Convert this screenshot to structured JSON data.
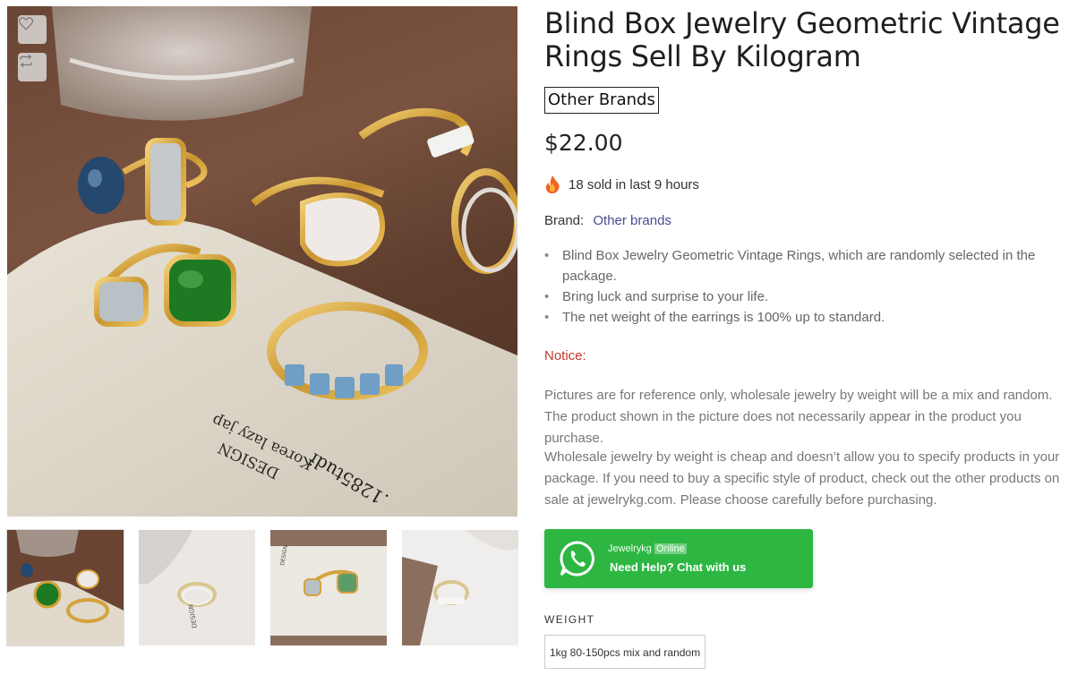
{
  "product": {
    "title": "Blind Box Jewelry Geometric Vintage Rings Sell By Kilogram",
    "brand_tag": "Other Brands",
    "price": "$22.00",
    "sold_text": "18 sold in last 9 hours",
    "brand_label": "Brand:",
    "brand_link": "Other brands",
    "features": [
      "Blind Box Jewelry Geometric Vintage Rings, which are randomly selected in the package.",
      "Bring luck and surprise to your life.",
      "The net weight of the earrings is 100% up to standard."
    ],
    "notice_label": "Notice:",
    "notice_paragraph_1": "Pictures are for reference only, wholesale jewelry by weight will be a mix and random. The product shown in the picture does not necessarily appear in the product you purchase.",
    "notice_paragraph_2": "Wholesale jewelry by weight is cheap and doesn’t allow you to specify products in your package. If you need to buy a specific style of product, check out the other products on sale at jewelrykg.com. Please choose carefully before purchasing."
  },
  "gallery": {
    "main_image_text": "DESIGN\nKorea lazy jap\n.1285tudi",
    "thumbnails": [
      "thumbnail-1",
      "thumbnail-2",
      "thumbnail-3",
      "thumbnail-4"
    ],
    "icons": {
      "wishlist": "heart-icon",
      "compare": "compare-icon"
    }
  },
  "chat": {
    "name": "Jewelrykg",
    "status": "Online",
    "cta": "Need Help? Chat with us",
    "icon": "whatsapp-icon",
    "color": "#2db742"
  },
  "variant": {
    "label": "WEIGHT",
    "options": [
      "1kg 80-150pcs mix and random"
    ]
  },
  "colors": {
    "notice": "#c0392b",
    "brand_link": "#4b4a8f"
  }
}
